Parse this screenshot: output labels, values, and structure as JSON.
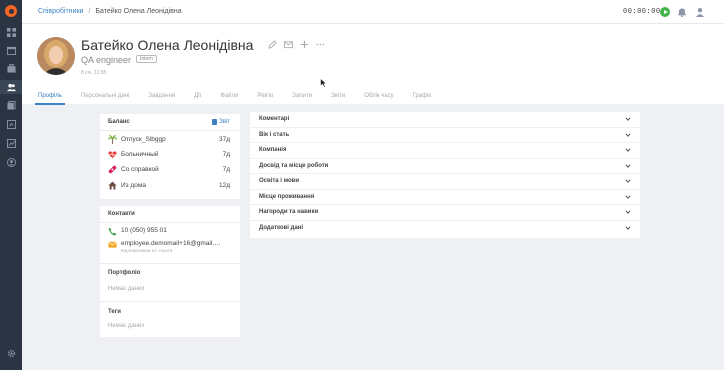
{
  "breadcrumb": {
    "parent": "Співробітники",
    "separator": "/",
    "current": "Батейко Олена Леонідівна"
  },
  "timer": "00:00:00",
  "profile": {
    "name": "Батейко Олена Леонідівна",
    "role": "QA engineer",
    "badge": "Intern",
    "date": "8 січ, 11:55"
  },
  "tabs": [
    "Профіль",
    "Персональні дані",
    "Завдання",
    "Дії",
    "Файли",
    "Рев'ю",
    "Запити",
    "Звіти",
    "Облік часу",
    "Графік"
  ],
  "balance": {
    "title": "Баланс",
    "report_label": "Звіт",
    "rows": [
      {
        "icon": "palm-tree-icon",
        "label": "Отпуск_Slbggp",
        "value": "37д",
        "color": "#7cb342"
      },
      {
        "icon": "heart-pulse-icon",
        "label": "Больничный",
        "value": "7д",
        "color": "#e53935"
      },
      {
        "icon": "bandage-icon",
        "label": "Со справкой",
        "value": "7д",
        "color": "#d81b60"
      },
      {
        "icon": "home-icon",
        "label": "Из дома",
        "value": "12д",
        "color": "#6d4c41"
      }
    ]
  },
  "contacts": {
    "title": "Контакти",
    "phone": "10 (050) 955 01",
    "email": "employee.demomail+16@gmail.c...",
    "email_note": "Корпоративна ел. пошта",
    "portfolio_title": "Портфоліо",
    "portfolio_value": "Немає даних",
    "tags_title": "Теги",
    "tags_value": "Немає даних"
  },
  "sections": [
    "Коментарі",
    "Вік і стать",
    "Компанія",
    "Досвід та місце роботи",
    "Освіта і мови",
    "Місце проживання",
    "Нагороди та навики",
    "Додаткові дані"
  ],
  "colors": {
    "accent": "#3b82c4",
    "sidebar": "#2b3442",
    "logo": "#f26522",
    "play": "#43b649"
  }
}
